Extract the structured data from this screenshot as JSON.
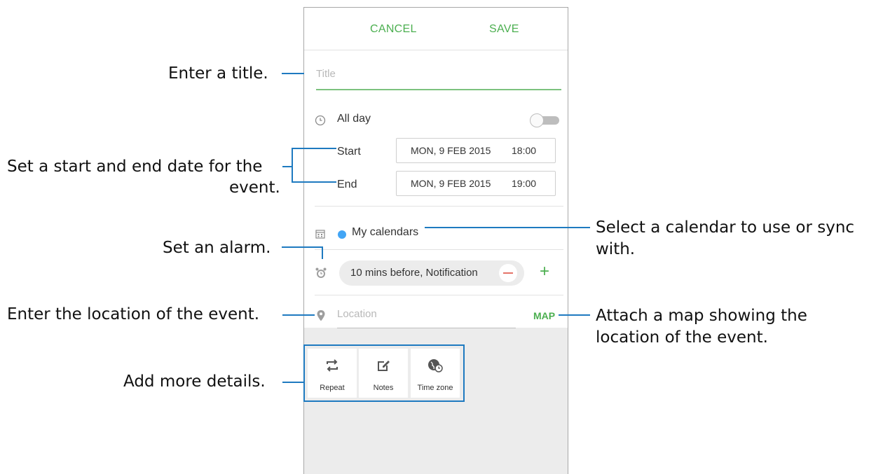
{
  "actionbar": {
    "cancel_label": "CANCEL",
    "save_label": "SAVE"
  },
  "form": {
    "title_placeholder": "Title",
    "allday_label": "All day",
    "allday_on": false,
    "start_label": "Start",
    "start_date": "MON, 9 FEB 2015",
    "start_time": "18:00",
    "end_label": "End",
    "end_date": "MON, 9 FEB 2015",
    "end_time": "19:00",
    "calendar_label": "My calendars",
    "calendar_color": "#42a5f5",
    "alarm_label": "10 mins before, Notification",
    "location_placeholder": "Location",
    "map_label": "MAP"
  },
  "details": [
    {
      "label": "Repeat",
      "icon": "repeat-icon"
    },
    {
      "label": "Notes",
      "icon": "edit-note-icon"
    },
    {
      "label": "Time zone",
      "icon": "globe-clock-icon"
    }
  ],
  "annotations": {
    "title": "Enter a title.",
    "dates_line1": "Set a start and end date for the",
    "dates_line2": "event.",
    "alarm": "Set an alarm.",
    "location": "Enter the location of the event.",
    "details": "Add more details.",
    "calendar_line1": "Select a calendar to use or sync",
    "calendar_line2": "with.",
    "map_line1": "Attach a map showing the",
    "map_line2": "location of the event."
  },
  "colors": {
    "accent_green": "#4caf50",
    "callout_blue": "#1e7ac0",
    "minus_red": "#e57368"
  }
}
